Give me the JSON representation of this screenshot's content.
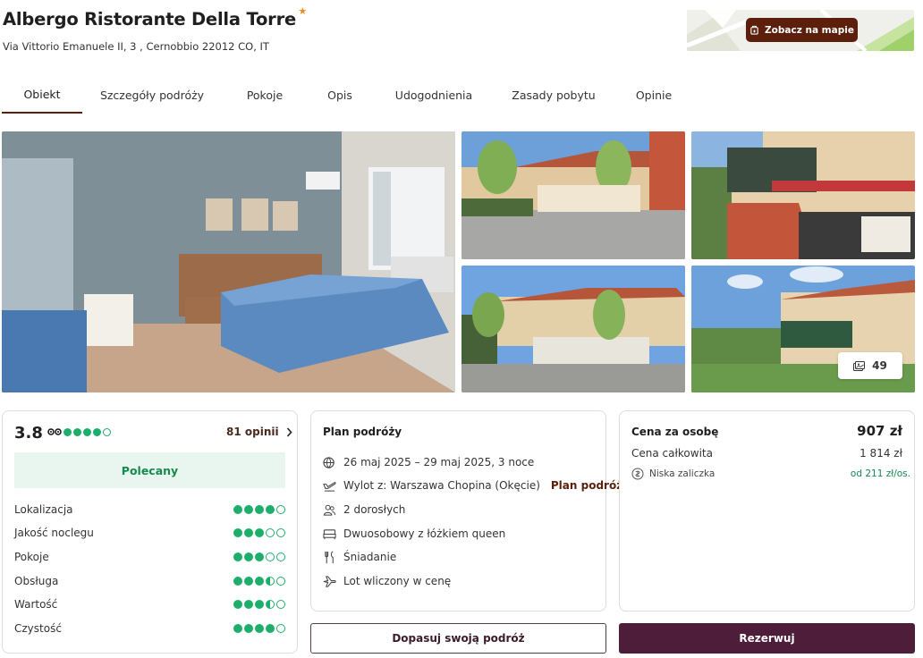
{
  "hotel": {
    "name": "Albergo Ristorante Della Torre",
    "star_glyph": "★",
    "address": "Via Vittorio Emanuele II, 3 , Cernobbio 22012 CO, IT"
  },
  "map": {
    "button_label": "Zobacz na mapie",
    "icon": "map-pin-icon"
  },
  "tabs": [
    {
      "label": "Obiekt",
      "active": true
    },
    {
      "label": "Szczegóły podróży"
    },
    {
      "label": "Pokoje"
    },
    {
      "label": "Opis"
    },
    {
      "label": "Udogodnienia"
    },
    {
      "label": "Zasady pobytu"
    },
    {
      "label": "Opinie"
    }
  ],
  "gallery": {
    "photo_count": "49",
    "icon": "gallery-icon"
  },
  "rating": {
    "score": "3.8",
    "score_dots": 4,
    "reviews_link": "81 opinii",
    "badge": "Polecany",
    "categories": [
      {
        "label": "Lokalizacja",
        "value": 4
      },
      {
        "label": "Jakość noclegu",
        "value": 3
      },
      {
        "label": "Pokoje",
        "value": 3
      },
      {
        "label": "Obsługa",
        "value": 3.5
      },
      {
        "label": "Wartość",
        "value": 3.5
      },
      {
        "label": "Czystość",
        "value": 4
      }
    ]
  },
  "plan": {
    "title": "Plan podróży",
    "dates": "26 maj 2025 – 29 maj 2025, 3 noce",
    "flight": "Wylot z: Warszawa Chopina (Okęcie)",
    "flight_link": "Plan podróży",
    "guests": "2 dorosłych",
    "room": "Dwuosobowy z łóżkiem queen",
    "board": "Śniadanie",
    "flight_included": "Lot wliczony w cenę"
  },
  "price": {
    "per_person_label": "Cena za osobę",
    "per_person_value": "907 zł",
    "total_label": "Cena całkowita",
    "total_value": "1 814 zł",
    "deposit_label": "Niska zaliczka",
    "deposit_value": "od 211 zł/os."
  },
  "actions": {
    "customize_label": "Dopasuj swoją podróż",
    "book_label": "Rezerwuj"
  },
  "colors": {
    "brand": "#5c1f0c",
    "book": "#4d1d3a",
    "rating_green": "#1dae6a"
  }
}
